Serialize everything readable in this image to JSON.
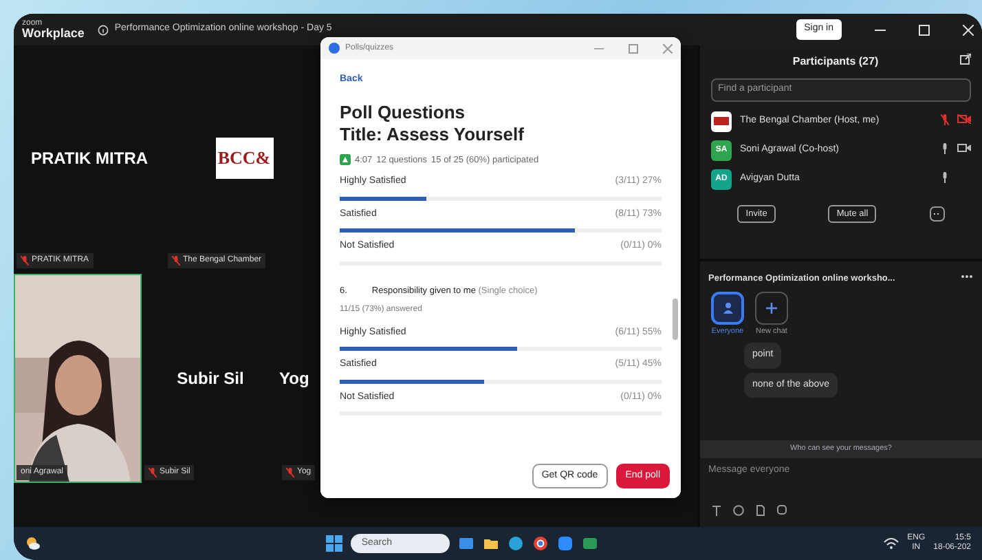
{
  "app": {
    "logo_top": "zoom",
    "logo_bottom": "Workplace",
    "meeting_title": "Performance Optimization online workshop - Day 5",
    "sign_in": "Sign in"
  },
  "video_rows": [
    {
      "tiles": [
        {
          "kind": "name",
          "name": "PRATIK MITRA",
          "label": "PRATIK MITRA",
          "muted": true
        },
        {
          "kind": "logo",
          "logo_text": "BCC&",
          "label": "The Bengal Chamber",
          "muted": true
        }
      ]
    },
    {
      "tiles": [
        {
          "kind": "video",
          "label": "oni Agrawal",
          "muted": false,
          "active": true
        },
        {
          "kind": "name",
          "name": "Subir Sil",
          "label": "Subir Sil",
          "muted": true
        },
        {
          "kind": "name",
          "name": "Yog",
          "label": "Yog",
          "muted": true
        }
      ]
    }
  ],
  "poll": {
    "window_title": "Polls/quizzes",
    "back": "Back",
    "heading": "Poll Questions",
    "subheading": "Title: Assess Yourself",
    "timer": "4:07",
    "questions_count": "12 questions",
    "participation": "15 of 25 (60%) participated",
    "questions": [
      {
        "options": [
          {
            "label": "Highly Satisfied",
            "result": "(3/11) 27%",
            "level": 0.27
          },
          {
            "label": "Satisfied",
            "result": "(8/11) 73%",
            "level": 0.73
          },
          {
            "label": "Not Satisfied",
            "result": "(0/11) 0%",
            "level": 0
          }
        ]
      },
      {
        "number": "6.",
        "text": "Responsibility given to me",
        "type": "(Single choice)",
        "answered": "11/15 (73%) answered",
        "options": [
          {
            "label": "Highly Satisfied",
            "result": "(6/11) 55%",
            "level": 0.55
          },
          {
            "label": "Satisfied",
            "result": "(5/11) 45%",
            "level": 0.45
          },
          {
            "label": "Not Satisfied",
            "result": "(0/11) 0%",
            "level": 0
          }
        ]
      }
    ],
    "buttons": [
      {
        "label": "Get QR code",
        "kind": "outline"
      },
      {
        "label": "End poll",
        "kind": "danger"
      }
    ]
  },
  "participants": {
    "title": "Participants (27)",
    "search": {
      "placeholder": "Find a participant"
    },
    "people": [
      {
        "name": "The Bengal Chamber (Host, me)",
        "kind": "logo",
        "mic_muted": true,
        "video_off": true
      },
      {
        "name": "Soni Agrawal (Co-host)",
        "kind": "initials",
        "initials": "SA",
        "color": "#2ea44f",
        "mic_muted": false,
        "video_off": false
      },
      {
        "name": "Avigyan Dutta",
        "kind": "initials",
        "initials": "AD",
        "color": "#14a38b",
        "mic_muted": false
      }
    ],
    "buttons": [
      "Invite",
      "Mute all"
    ]
  },
  "chat": {
    "title": "Performance Optimization online worksho...",
    "tabs": [
      {
        "label": "Everyone",
        "selected": true
      },
      {
        "label": "New chat",
        "selected": false
      }
    ],
    "messages": [
      "point",
      "none of the above"
    ],
    "notice": "Who can see your messages?",
    "input": {
      "placeholder": "Message everyone"
    }
  },
  "taskbar": {
    "search": {
      "placeholder": "Search"
    },
    "language": "ENG",
    "region": "IN",
    "time": "15:5",
    "date": "18-06-202"
  }
}
